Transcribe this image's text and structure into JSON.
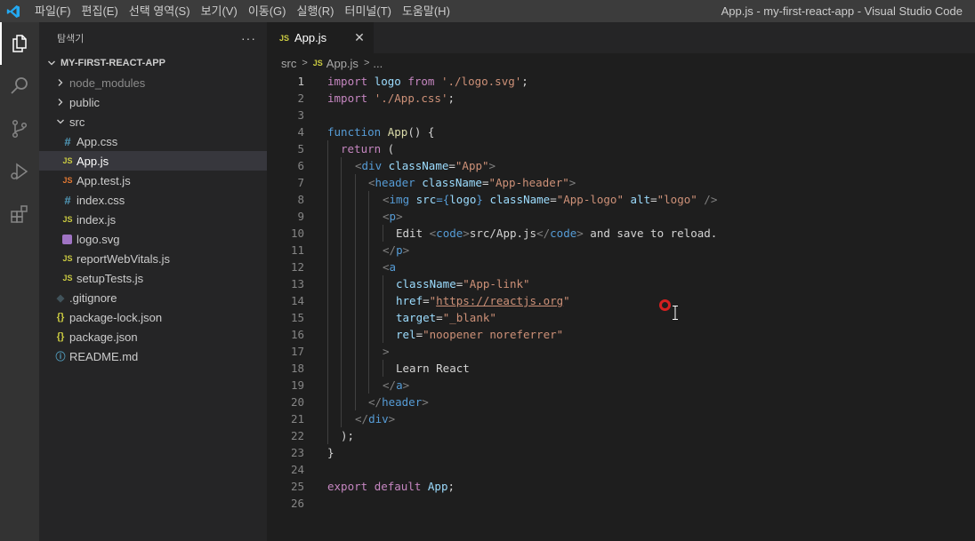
{
  "titlebar": {
    "menu": [
      "파일(F)",
      "편집(E)",
      "선택 영역(S)",
      "보기(V)",
      "이동(G)",
      "실행(R)",
      "터미널(T)",
      "도움말(H)"
    ],
    "window_title": "App.js - my-first-react-app - Visual Studio Code"
  },
  "sidebar": {
    "title": "탐색기",
    "more": "···",
    "project": "MY-FIRST-REACT-APP",
    "items": [
      {
        "label": "node_modules",
        "type": "folder",
        "icon": "chevron-right"
      },
      {
        "label": "public",
        "type": "folder",
        "icon": "chevron-right"
      },
      {
        "label": "src",
        "type": "folder",
        "icon": "chevron-down"
      },
      {
        "label": "App.css",
        "type": "css",
        "icon_text": "#"
      },
      {
        "label": "App.js",
        "type": "js",
        "icon_text": "JS",
        "selected": true
      },
      {
        "label": "App.test.js",
        "type": "js",
        "icon_text": "JS"
      },
      {
        "label": "index.css",
        "type": "css",
        "icon_text": "#"
      },
      {
        "label": "index.js",
        "type": "js",
        "icon_text": "JS"
      },
      {
        "label": "logo.svg",
        "type": "svg"
      },
      {
        "label": "reportWebVitals.js",
        "type": "js",
        "icon_text": "JS"
      },
      {
        "label": "setupTests.js",
        "type": "js",
        "icon_text": "JS"
      },
      {
        "label": ".gitignore",
        "type": "git",
        "icon_text": "◆"
      },
      {
        "label": "package-lock.json",
        "type": "json",
        "icon_text": "{}"
      },
      {
        "label": "package.json",
        "type": "json",
        "icon_text": "{}"
      },
      {
        "label": "README.md",
        "type": "info",
        "icon_text": "ⓘ"
      }
    ]
  },
  "editor": {
    "tab": {
      "icon_text": "JS",
      "label": "App.js",
      "close": "✕"
    },
    "breadcrumb": {
      "folder": "src",
      "sep": ">",
      "icon_text": "JS",
      "file": "App.js",
      "more": "..."
    },
    "line_numbers": [
      "1",
      "2",
      "3",
      "4",
      "5",
      "6",
      "7",
      "8",
      "9",
      "10",
      "11",
      "12",
      "13",
      "14",
      "15",
      "16",
      "17",
      "18",
      "19",
      "20",
      "21",
      "22",
      "23",
      "24",
      "25",
      "26"
    ],
    "code": {
      "l1": [
        "import",
        " ",
        "logo",
        " ",
        "from",
        " ",
        "'./logo.svg'",
        ";"
      ],
      "l2": [
        "import",
        " ",
        "'./App.css'",
        ";"
      ],
      "l4": [
        "function",
        " ",
        "App",
        "() {"
      ],
      "l5": [
        "return",
        " ("
      ],
      "l6": [
        "<",
        "div",
        " ",
        "className",
        "=",
        "\"App\"",
        ">"
      ],
      "l7": [
        "<",
        "header",
        " ",
        "className",
        "=",
        "\"App-header\"",
        ">"
      ],
      "l8": [
        "<",
        "img",
        " ",
        "src",
        "={",
        "logo",
        "} ",
        "className",
        "=",
        "\"App-logo\"",
        " ",
        "alt",
        "=",
        "\"logo\"",
        " />"
      ],
      "l9": [
        "<",
        "p",
        ">"
      ],
      "l10": [
        "Edit ",
        "<",
        "code",
        ">",
        "src/App.js",
        "</",
        "code",
        ">",
        " and save to reload."
      ],
      "l11": [
        "</",
        "p",
        ">"
      ],
      "l12": [
        "<",
        "a"
      ],
      "l13": [
        "className",
        "=",
        "\"App-link\""
      ],
      "l14": [
        "href",
        "=",
        "\"",
        "https://reactjs.org",
        "\""
      ],
      "l15": [
        "target",
        "=",
        "\"_blank\""
      ],
      "l16": [
        "rel",
        "=",
        "\"noopener noreferrer\""
      ],
      "l17": [
        ">"
      ],
      "l18": [
        "Learn React"
      ],
      "l19": [
        "</",
        "a",
        ">"
      ],
      "l20": [
        "</",
        "header",
        ">"
      ],
      "l21": [
        "</",
        "div",
        ">"
      ],
      "l22": [
        ");"
      ],
      "l23": [
        "}"
      ],
      "l25": [
        "export",
        " ",
        "default",
        " ",
        "App",
        ";"
      ]
    }
  },
  "colors": {
    "keyword": "#569cd6",
    "control": "#c586c0",
    "variable": "#9cdcfe",
    "function": "#dcdcaa",
    "string": "#ce9178",
    "accent": "#007acc"
  }
}
